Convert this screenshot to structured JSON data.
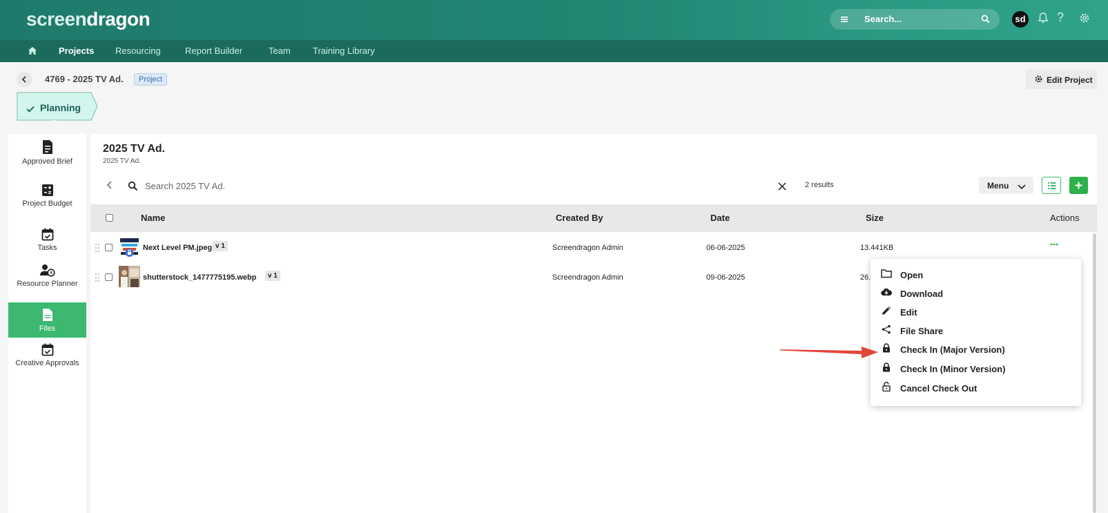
{
  "app": {
    "logo_prefix": "screen",
    "logo_suffix": "dragon",
    "search_placeholder": "Search...",
    "avatar_initials": "sd"
  },
  "nav": {
    "items": [
      "Projects",
      "Resourcing",
      "Report Builder",
      "Team",
      "Training Library"
    ],
    "active": "Projects"
  },
  "project": {
    "title": "4769 - 2025 TV Ad.",
    "badge": "Project",
    "edit_label": "Edit Project",
    "stage": "Planning"
  },
  "sidebar": {
    "items": [
      {
        "label": "Approved Brief",
        "icon": "document-check-icon"
      },
      {
        "label": "Project Budget",
        "icon": "calculator-icon"
      },
      {
        "label": "Tasks",
        "icon": "calendar-check-icon"
      },
      {
        "label": "Resource Planner",
        "icon": "person-clock-icon"
      },
      {
        "label": "Files",
        "icon": "file-icon",
        "active": true
      },
      {
        "label": "Creative Approvals",
        "icon": "calendar-check-icon"
      }
    ]
  },
  "folder": {
    "title": "2025 TV Ad.",
    "subtitle": "2025 TV Ad.",
    "search_placeholder": "Search 2025 TV Ad.",
    "results": "2 results",
    "menu_label": "Menu"
  },
  "table": {
    "headers": [
      "Name",
      "Created By",
      "Date",
      "Size",
      "Actions"
    ],
    "rows": [
      {
        "name": "Next Level PM.jpeg",
        "version": "v 1",
        "created_by": "Screendragon Admin",
        "date": "06-06-2025",
        "size": "13.441KB",
        "locked": true
      },
      {
        "name": "shutterstock_1477775195.webp",
        "version": "v 1",
        "created_by": "Screendragon Admin",
        "date": "09-06-2025",
        "size": "26.",
        "locked": false
      }
    ]
  },
  "context_menu": {
    "items": [
      {
        "label": "Open",
        "icon": "folder-icon"
      },
      {
        "label": "Download",
        "icon": "cloud-download-icon"
      },
      {
        "label": "Edit",
        "icon": "pencil-icon"
      },
      {
        "label": "File Share",
        "icon": "share-icon"
      },
      {
        "label": "Check In (Major Version)",
        "icon": "lock-icon"
      },
      {
        "label": "Check In (Minor Version)",
        "icon": "lock-icon"
      },
      {
        "label": "Cancel Check Out",
        "icon": "unlock-icon"
      }
    ]
  },
  "colors": {
    "header": "#228673",
    "nav": "#1b6b5d",
    "accent": "#3cb870",
    "arrow": "#e2453a"
  }
}
